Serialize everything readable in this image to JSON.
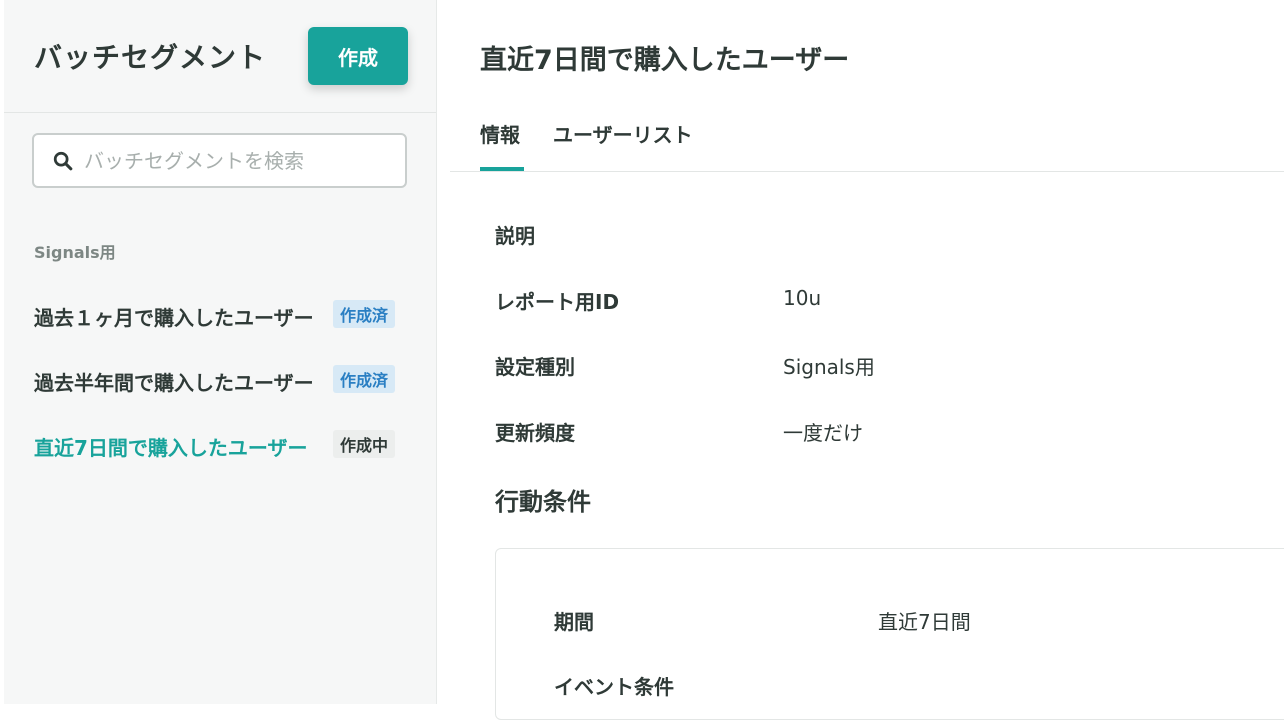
{
  "sidebar": {
    "title": "バッチセグメント",
    "create_label": "作成",
    "search_placeholder": "バッチセグメントを検索",
    "section_label": "Signals用",
    "items": [
      {
        "name": "過去１ヶ月で購入したユーザー",
        "status": "作成済"
      },
      {
        "name": "過去半年間で購入したユーザー",
        "status": "作成済"
      },
      {
        "name": "直近7日間で購入したユーザー",
        "status": "作成中"
      }
    ]
  },
  "main": {
    "title": "直近7日間で購入したユーザー",
    "tabs": [
      {
        "label": "情報"
      },
      {
        "label": "ユーザーリスト"
      }
    ],
    "info": {
      "description_label": "説明",
      "description_value": "",
      "report_id_label": "レポート用ID",
      "report_id_value": "10u",
      "type_label": "設定種別",
      "type_value": "Signals用",
      "frequency_label": "更新頻度",
      "frequency_value": "一度だけ"
    },
    "conditions": {
      "title": "行動条件",
      "period_label": "期間",
      "period_value": "直近7日間",
      "event_label": "イベント条件"
    }
  },
  "colors": {
    "accent": "#18a39b",
    "badge_done_bg": "#d7e9f6",
    "badge_done_text": "#2a7fc3"
  }
}
